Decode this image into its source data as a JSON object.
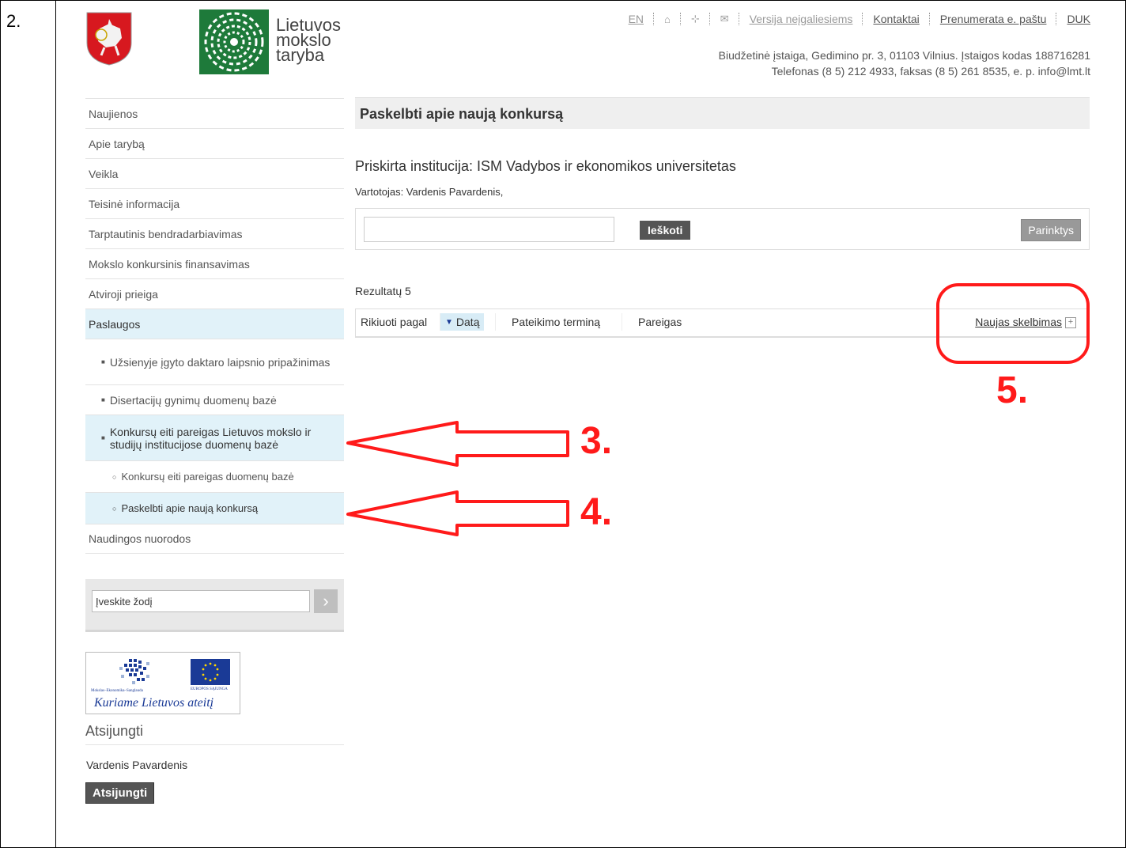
{
  "step_number": "2.",
  "header": {
    "org_name": [
      "Lietuvos",
      "mokslo",
      "taryba"
    ],
    "top_links": {
      "en": "EN",
      "accessible_version": "Versija neįgaliesiems",
      "contacts": "Kontaktai",
      "subscribe": "Prenumerata e. paštu",
      "faq": "DUK"
    },
    "address_line1": "Biudžetinė įstaiga, Gedimino pr. 3, 01103 Vilnius. Įstaigos kodas 188716281",
    "address_line2": "Telefonas (8 5) 212 4933, faksas (8 5) 261 8535, e. p. info@lmt.lt"
  },
  "sidebar": {
    "items": [
      {
        "label": "Naujienos"
      },
      {
        "label": "Apie tarybą"
      },
      {
        "label": "Veikla"
      },
      {
        "label": "Teisinė informacija"
      },
      {
        "label": "Tarptautinis bendradarbiavimas"
      },
      {
        "label": "Mokslo konkursinis finansavimas"
      },
      {
        "label": "Atviroji prieiga"
      },
      {
        "label": "Paslaugos"
      }
    ],
    "sub_items": [
      {
        "label": "Užsienyje įgyto daktaro laipsnio pripažinimas"
      },
      {
        "label": "Disertacijų gynimų duomenų bazė"
      },
      {
        "label": "Konkursų eiti pareigas Lietuvos mokslo ir studijų institucijose duomenų bazė"
      }
    ],
    "subsub_items": [
      {
        "label": "Konkursų eiti pareigas duomenų bazė"
      },
      {
        "label": "Paskelbti apie naują konkursą"
      }
    ],
    "last_item": "Naudingos nuorodos",
    "search_placeholder": "Įveskite žodį",
    "search_value": "Įveskite žodį",
    "eu_slogan": "Kuriame Lietuvos ateitį",
    "eu_left_caption": "Mokslas–Ekonomika–Sanglauda",
    "eu_right_caption": "EUROPOS SĄJUNGA",
    "logout_title": "Atsijungti",
    "user_name": "Vardenis Pavardenis",
    "logout_button": "Atsijungti"
  },
  "main": {
    "page_title": "Paskelbti apie naują konkursą",
    "institution": "Priskirta institucija: ISM Vadybos ir ekonomikos universitetas",
    "user_line": "Vartotojas: Vardenis Pavardenis,",
    "search_button": "Ieškoti",
    "options_button": "Parinktys",
    "results_count": "Rezultatų 5",
    "sort_label": "Rikiuoti pagal",
    "sort_options": [
      "Datą",
      "Pateikimo terminą",
      "Pareigas"
    ],
    "new_ad": "Naujas skelbimas"
  },
  "annotations": [
    "3.",
    "4.",
    "5."
  ],
  "colors": {
    "annotation": "#ff1a1a",
    "active_nav": "#e1f2f9",
    "eu_blue": "#1a3a96"
  }
}
